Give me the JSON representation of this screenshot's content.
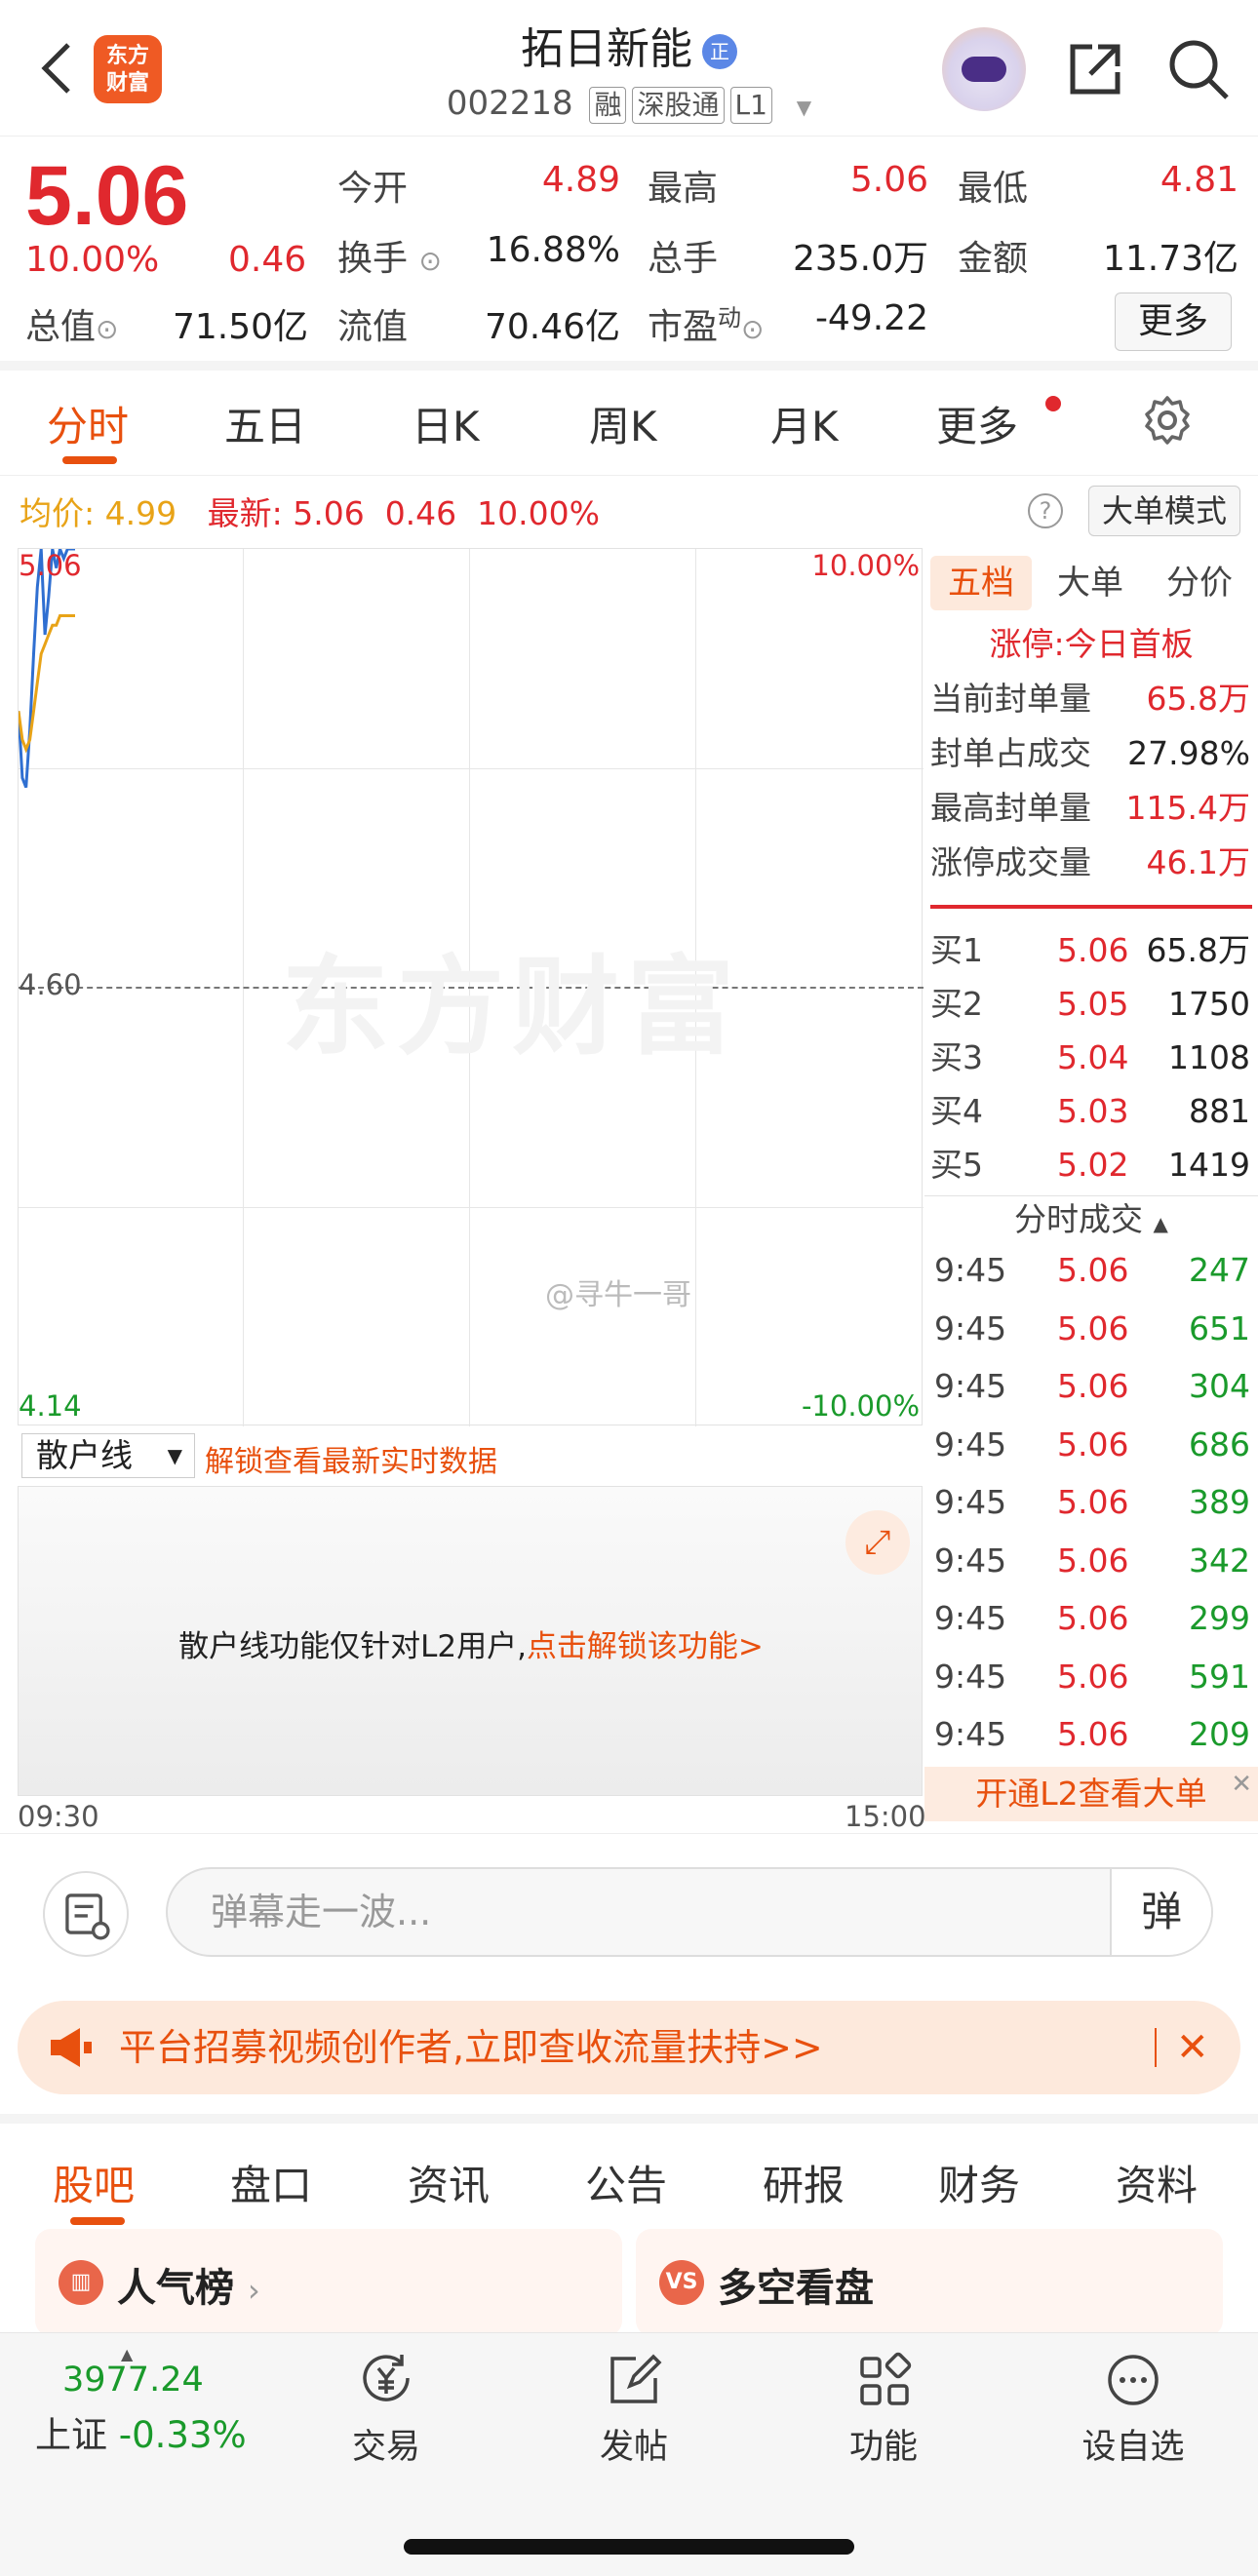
{
  "header": {
    "logo_text": "东方财富",
    "stock_name": "拓日新能",
    "zheng_badge": "正",
    "stock_code": "002218",
    "tags": [
      "融",
      "深股通",
      "L1"
    ]
  },
  "quote": {
    "price": "5.06",
    "change_pct": "10.00%",
    "change": "0.46",
    "open_label": "今开",
    "open": "4.89",
    "high_label": "最高",
    "high": "5.06",
    "low_label": "最低",
    "low": "4.81",
    "turnover_label": "换手",
    "turnover": "16.88%",
    "vol_label": "总手",
    "vol": "235.0万",
    "amount_label": "金额",
    "amount": "11.73亿",
    "mcap_label": "总值",
    "mcap": "71.50亿",
    "float_label": "流值",
    "float_cap": "70.46亿",
    "pe_label": "市盈",
    "pe_sup": "动",
    "pe": "-49.22",
    "more_label": "更多"
  },
  "tabs": [
    "分时",
    "五日",
    "日K",
    "周K",
    "月K",
    "更多"
  ],
  "info": {
    "avg_label": "均价:",
    "avg": "4.99",
    "latest_label": "最新:",
    "latest": "5.06",
    "latest_chg": "0.46",
    "latest_pct": "10.00%",
    "big_mode": "大单模式"
  },
  "chart": {
    "top_price": "5.06",
    "top_pct": "10.00%",
    "mid_price": "4.60",
    "bottom_price": "4.14",
    "bottom_pct": "-10.00%",
    "watermark": "东方财富",
    "weibo": "@寻牛一哥",
    "time_start": "09:30",
    "time_end": "15:00"
  },
  "chart_data": {
    "type": "line",
    "x": [
      "09:30",
      "09:31",
      "09:32",
      "09:33",
      "09:34",
      "09:35",
      "09:36",
      "09:37",
      "09:38",
      "09:39",
      "09:40",
      "09:41",
      "09:42",
      "09:43",
      "09:44",
      "09:45"
    ],
    "series": [
      {
        "values": [
          4.89,
          4.82,
          4.81,
          4.87,
          4.95,
          5.02,
          5.06,
          4.97,
          5.01,
          5.06,
          5.04,
          5.06,
          5.05,
          5.06,
          5.06,
          5.06
        ]
      },
      {
        "values": [
          4.89,
          4.86,
          4.85,
          4.86,
          4.89,
          4.92,
          4.95,
          4.96,
          4.97,
          4.98,
          4.98,
          4.99,
          4.99,
          4.99,
          4.99,
          4.99
        ]
      }
    ],
    "ylim": [
      4.14,
      5.06
    ],
    "colors": [
      "#2f6fd1",
      "#e8a317"
    ]
  },
  "side": {
    "tabs": [
      "五档",
      "大单",
      "分价"
    ],
    "limit_label": "涨停:",
    "limit_text": "今日首板",
    "stats": [
      {
        "label": "当前封单量",
        "value": "65.8万"
      },
      {
        "label": "封单占成交",
        "value": "27.98%"
      },
      {
        "label": "最高封单量",
        "value": "115.4万"
      },
      {
        "label": "涨停成交量",
        "value": "46.1万"
      }
    ],
    "bids": [
      {
        "label": "买1",
        "price": "5.06",
        "vol": "65.8万"
      },
      {
        "label": "买2",
        "price": "5.05",
        "vol": "1750"
      },
      {
        "label": "买3",
        "price": "5.04",
        "vol": "1108"
      },
      {
        "label": "买4",
        "price": "5.03",
        "vol": "881"
      },
      {
        "label": "买5",
        "price": "5.02",
        "vol": "1419"
      }
    ],
    "trades_title": "分时成交",
    "trades": [
      {
        "t": "9:45",
        "p": "5.06",
        "v": "247"
      },
      {
        "t": "9:45",
        "p": "5.06",
        "v": "651"
      },
      {
        "t": "9:45",
        "p": "5.06",
        "v": "304"
      },
      {
        "t": "9:45",
        "p": "5.06",
        "v": "686"
      },
      {
        "t": "9:45",
        "p": "5.06",
        "v": "389"
      },
      {
        "t": "9:45",
        "p": "5.06",
        "v": "342"
      },
      {
        "t": "9:45",
        "p": "5.06",
        "v": "299"
      },
      {
        "t": "9:45",
        "p": "5.06",
        "v": "591"
      },
      {
        "t": "9:45",
        "p": "5.06",
        "v": "209"
      }
    ],
    "l2_text": "开通L2查看大单"
  },
  "sub": {
    "dropdown": "散户线",
    "unlock_link": "解锁查看最新实时数据",
    "panel_text": "散户线功能仅针对L2用户,",
    "panel_link": "点击解锁该功能>"
  },
  "danmu": {
    "placeholder": "弹幕走一波...",
    "button": "弹"
  },
  "banner": {
    "text": "平台招募视频创作者,立即查收流量扶持>>",
    "close": "✕"
  },
  "bottom_tabs": [
    "股吧",
    "盘口",
    "资讯",
    "公告",
    "研报",
    "财务",
    "资料"
  ],
  "cards": [
    {
      "title": "人气榜"
    },
    {
      "title": "多空看盘"
    }
  ],
  "footer": {
    "index_value": "3977.24",
    "index_name": "上证",
    "index_pct": "-0.33%",
    "nav": [
      "交易",
      "发帖",
      "功能",
      "设自选"
    ]
  }
}
